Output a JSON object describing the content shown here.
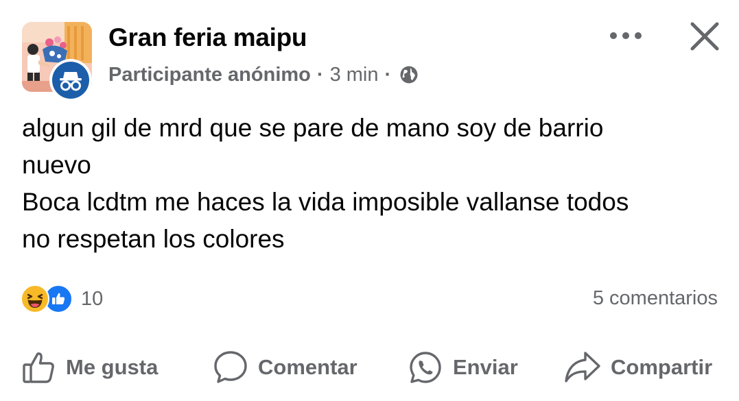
{
  "post": {
    "group_name": "Gran feria maipu",
    "author": "Participante anónimo",
    "separator": "·",
    "time": "3 min",
    "privacy_icon": "globe-icon",
    "text_lines": [
      "algun gil de mrd que se pare de mano soy de barrio",
      "nuevo",
      "Boca lcdtm me haces la vida imposible vallanse todos",
      "no respetan los colores"
    ]
  },
  "header_actions": {
    "more_icon": "more-options-icon",
    "close_icon": "close-icon"
  },
  "reactions": {
    "types": [
      "haha",
      "like"
    ],
    "count": "10",
    "comments": "5 comentarios"
  },
  "actions": {
    "like": "Me gusta",
    "comment": "Comentar",
    "send": "Enviar",
    "share": "Compartir"
  },
  "colors": {
    "text": "#050505",
    "secondary": "#65676b",
    "like_blue": "#1877f2",
    "anon_badge": "#1c5ea9",
    "haha_yellow": "#f7b928"
  }
}
